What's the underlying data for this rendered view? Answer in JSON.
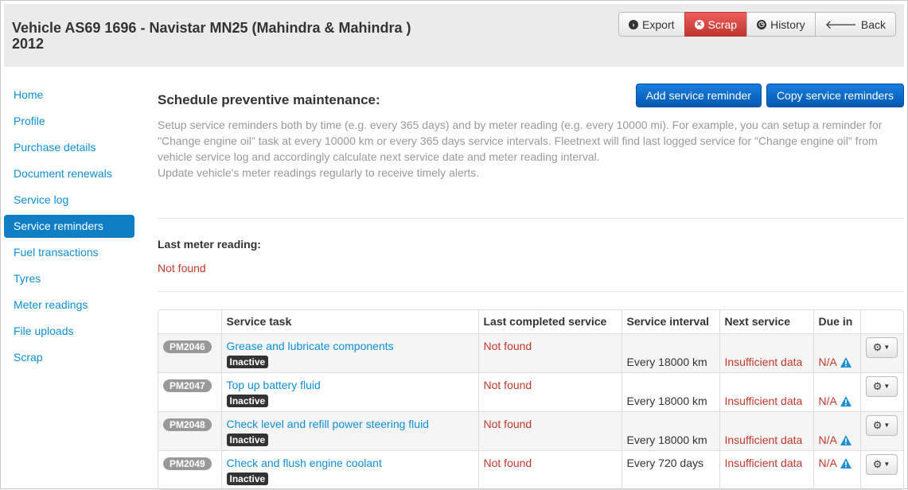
{
  "header": {
    "title": "Vehicle AS69 1696 - Navistar MN25 (Mahindra & Mahindra ) 2012",
    "buttons": {
      "export": "Export",
      "scrap": "Scrap",
      "history": "History",
      "back": "Back"
    }
  },
  "sidebar": {
    "items": [
      {
        "label": "Home"
      },
      {
        "label": "Profile"
      },
      {
        "label": "Purchase details"
      },
      {
        "label": "Document renewals"
      },
      {
        "label": "Service log"
      },
      {
        "label": "Service reminders",
        "active": true
      },
      {
        "label": "Fuel transactions"
      },
      {
        "label": "Tyres"
      },
      {
        "label": "Meter readings"
      },
      {
        "label": "File uploads"
      },
      {
        "label": "Scrap"
      }
    ]
  },
  "main": {
    "heading": "Schedule preventive maintenance:",
    "add_button": "Add service reminder",
    "copy_button": "Copy service reminders",
    "help_line1": "Setup service reminders both by time (e.g. every 365 days) and by meter reading (e.g. every 10000 mi). For example, you can setup a reminder for \"Change engine oil\" task at every 10000 km or every 365 days service intervals. Fleetnext will find last logged service for \"Change engine oil\" from vehicle service log and accordingly calculate next service date and meter reading interval.",
    "help_line2": "Update vehicle's meter readings regularly to receive timely alerts.",
    "last_meter_label": "Last meter reading:",
    "last_meter_value": "Not found"
  },
  "table": {
    "headers": [
      "Service task",
      "Last completed service",
      "Service interval",
      "Next service",
      "Due in"
    ],
    "rows": [
      {
        "id": "PM2046",
        "task": "Grease and lubricate components",
        "status": "Inactive",
        "last": "Not found",
        "interval": "Every 18000 km",
        "next": "Insufficient data",
        "due": "N/A"
      },
      {
        "id": "PM2047",
        "task": "Top up battery fluid",
        "status": "Inactive",
        "last": "Not found",
        "interval": "Every 18000 km",
        "next": "Insufficient data",
        "due": "N/A"
      },
      {
        "id": "PM2048",
        "task": "Check level and refill power steering fluid",
        "status": "Inactive",
        "last": "Not found",
        "interval": "Every 18000 km",
        "next": "Insufficient data",
        "due": "N/A"
      },
      {
        "id": "PM2049",
        "task": "Check and flush engine coolant",
        "status": "Inactive",
        "last": "Not found",
        "interval": "Every 720 days",
        "next": "Insufficient data",
        "due": "N/A"
      }
    ]
  },
  "colors": {
    "accent": "#0e8fd6",
    "danger": "#bd362f",
    "error_text": "#c0392b",
    "primary": "#0066cc"
  }
}
